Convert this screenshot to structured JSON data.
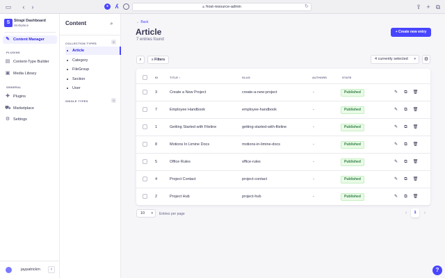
{
  "browser": {
    "url": "frost-resource-admin",
    "icons": [
      "sidebar-icon",
      "back-icon",
      "forward-icon",
      "share-icon",
      "new-tab-icon",
      "tabs-icon"
    ]
  },
  "brand": {
    "name": "Strapi Dashboard",
    "subtitle": "Workplace"
  },
  "nav": {
    "content_manager": "Content Manager",
    "plugins_heading": "PLUGINS",
    "content_type_builder": "Content-Type Builder",
    "media_library": "Media Library",
    "general_heading": "GENERAL",
    "plugins": "Plugins",
    "marketplace": "Marketplace",
    "settings": "Settings",
    "user": "jaypatrickm"
  },
  "subnav": {
    "title": "Content",
    "collection_heading": "COLLECTION TYPES",
    "collection_count": "5",
    "items": [
      "Article",
      "Category",
      "FileGroup",
      "Section",
      "User"
    ],
    "single_heading": "SINGLE TYPES",
    "single_count": "0"
  },
  "main": {
    "back_label": "Back",
    "title": "Article",
    "subtitle": "7 entries found",
    "create_label": "Create new entry",
    "filters_label": "Filters",
    "columns_select": "4 currently selected"
  },
  "table": {
    "headers": {
      "id": "ID",
      "title": "TITLE",
      "slug": "SLUG",
      "authors": "AUTHORS",
      "state": "STATE"
    },
    "rows": [
      {
        "id": "3",
        "title": "Create a New Project",
        "slug": "create-a-new-project",
        "authors": "-",
        "state": "Published"
      },
      {
        "id": "7",
        "title": "Employee Handbook",
        "slug": "employee-handbook",
        "authors": "-",
        "state": "Published"
      },
      {
        "id": "1",
        "title": "Getting Started with Fileline",
        "slug": "getting-started-with-fileline",
        "authors": "-",
        "state": "Published"
      },
      {
        "id": "8",
        "title": "Motions In Limine Docs",
        "slug": "motions-in-limine-docs",
        "authors": "-",
        "state": "Published"
      },
      {
        "id": "5",
        "title": "Office Rules",
        "slug": "office-rules",
        "authors": "-",
        "state": "Published"
      },
      {
        "id": "4",
        "title": "Project Contact",
        "slug": "project-contact",
        "authors": "-",
        "state": "Published"
      },
      {
        "id": "2",
        "title": "Project Hub",
        "slug": "project-hub",
        "authors": "-",
        "state": "Published"
      }
    ]
  },
  "pagination": {
    "per_page": "10",
    "per_page_label": "Entries per page",
    "current_page": "1"
  },
  "colors": {
    "primary": "#4945ff",
    "published_bg": "#eafbe7",
    "published_text": "#328048"
  }
}
